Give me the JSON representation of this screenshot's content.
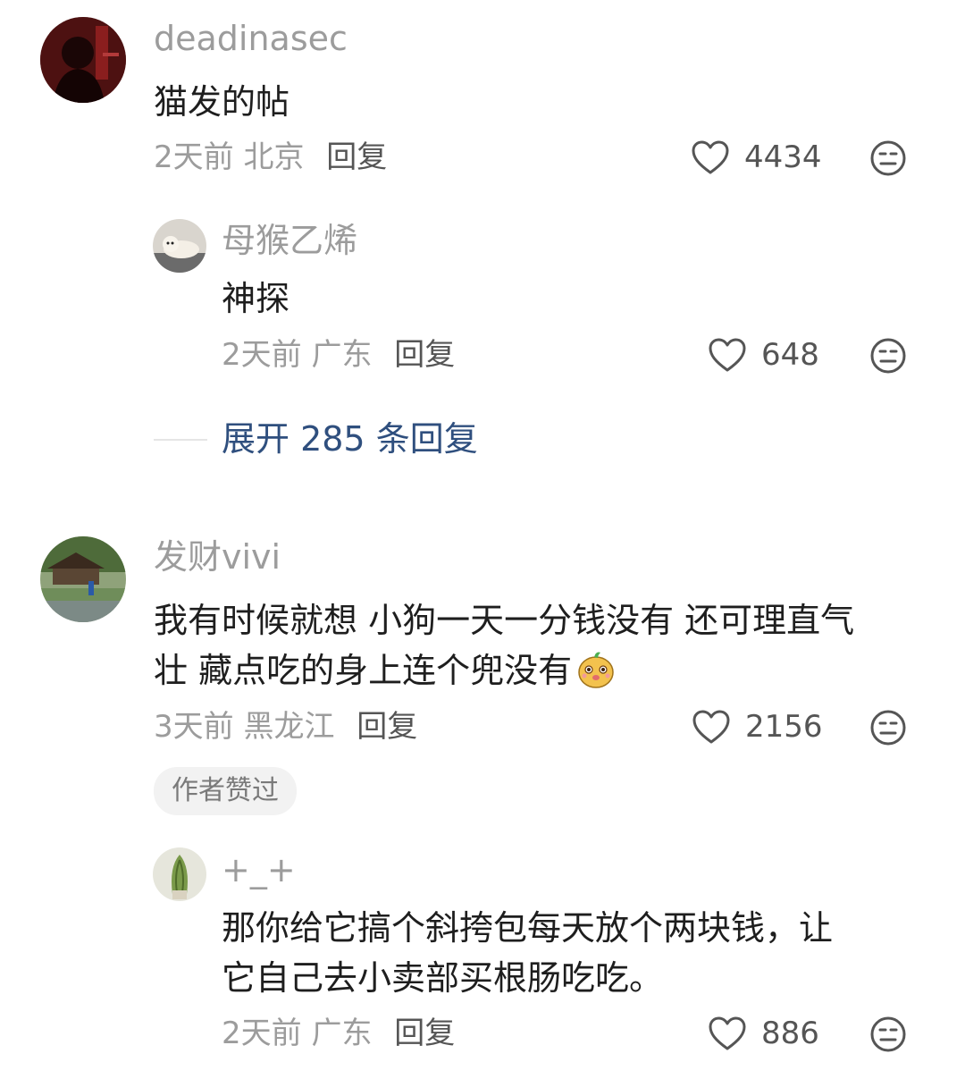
{
  "comments": [
    {
      "username": "deadinasec",
      "content": "猫发的帖",
      "time": "2天前",
      "location": "北京",
      "reply_label": "回复",
      "likes": "4434",
      "avatar_icon": "dark-red-portrait-avatar",
      "replies": [
        {
          "username": "母猴乙烯",
          "content": "神探",
          "time": "2天前",
          "location": "广东",
          "reply_label": "回复",
          "likes": "648",
          "avatar_icon": "white-dog-avatar"
        }
      ],
      "expand_label": "展开 285 条回复"
    },
    {
      "username": "发财vivi",
      "content_line1": "我有时候就想 小狗一天一分钱没有 还可理直气",
      "content_line2": "壮 藏点吃的身上连个兜没有",
      "content_emoji": "smiling-potato-emoji",
      "time": "3天前",
      "location": "黑龙江",
      "reply_label": "回复",
      "likes": "2156",
      "badge": "作者赞过",
      "avatar_icon": "garden-pavilion-avatar",
      "replies": [
        {
          "username": "+_+",
          "content_line1": "那你给它搞个斜挎包每天放个两块钱，让",
          "content_line2": "它自己去小卖部买根肠吃吃。",
          "time": "2天前",
          "location": "广东",
          "reply_label": "回复",
          "likes": "886",
          "avatar_icon": "green-plant-avatar"
        }
      ]
    }
  ],
  "colors": {
    "username": "#9c9c9c",
    "text": "#1e1e1e",
    "expand_link": "#2f4f7e",
    "badge_bg": "#f2f2f2"
  },
  "icons": {
    "like": "heart-outline-icon",
    "dislike": "unhappy-face-icon"
  }
}
